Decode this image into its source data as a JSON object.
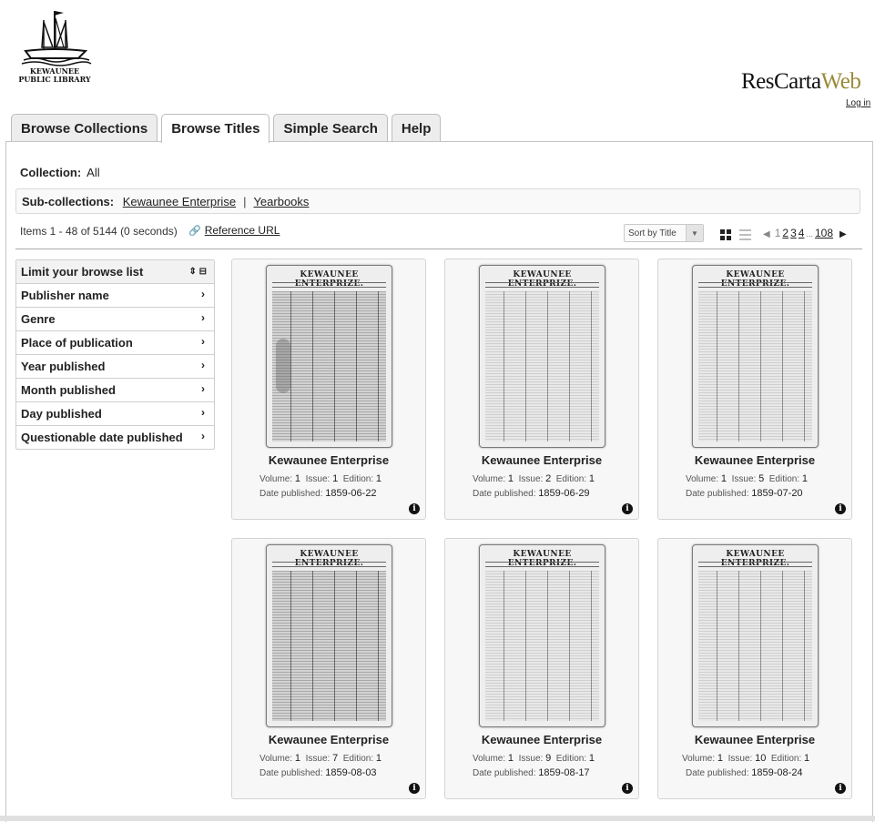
{
  "header": {
    "logo_line1": "KEWAUNEE",
    "logo_line2": "PUBLIC LIBRARY",
    "brand_main": "ResCarta",
    "brand_web": "Web",
    "login": "Log in"
  },
  "tabs": [
    {
      "label": "Browse Collections",
      "active": false
    },
    {
      "label": "Browse Titles",
      "active": true
    },
    {
      "label": "Simple Search",
      "active": false
    },
    {
      "label": "Help",
      "active": false
    }
  ],
  "collection": {
    "label": "Collection:",
    "value": "All"
  },
  "subcollections": {
    "label": "Sub-collections:",
    "items": [
      "Kewaunee Enterprise",
      "Yearbooks"
    ],
    "separator": "|"
  },
  "results": {
    "summary": "Items 1 - 48 of 5144 (0 seconds)",
    "reference_url": "Reference URL"
  },
  "sort": {
    "selected": "Sort by Title"
  },
  "pager": {
    "current": "1",
    "pages": [
      "2",
      "3",
      "4"
    ],
    "ellipsis": "...",
    "last": "108"
  },
  "facets": {
    "header": "Limit your browse list",
    "items": [
      "Publisher name",
      "Genre",
      "Place of publication",
      "Year published",
      "Month published",
      "Day published",
      "Questionable date published"
    ]
  },
  "card_labels": {
    "volume": "Volume:",
    "issue": "Issue:",
    "edition": "Edition:",
    "date": "Date published:"
  },
  "cards": [
    {
      "masthead": "KEWAUNEE ENTERPRIZE.",
      "title": "Kewaunee Enterprise",
      "volume": "1",
      "issue": "1",
      "edition": "1",
      "date": "1859-06-22"
    },
    {
      "masthead": "KEWAUNEE ENTERPRIZE.",
      "title": "Kewaunee Enterprise",
      "volume": "1",
      "issue": "2",
      "edition": "1",
      "date": "1859-06-29"
    },
    {
      "masthead": "KEWAUNEE ENTERPRIZE.",
      "title": "Kewaunee Enterprise",
      "volume": "1",
      "issue": "5",
      "edition": "1",
      "date": "1859-07-20"
    },
    {
      "masthead": "KEWAUNEE ENTERPRIZE.",
      "title": "Kewaunee Enterprise",
      "volume": "1",
      "issue": "7",
      "edition": "1",
      "date": "1859-08-03"
    },
    {
      "masthead": "KEWAUNEE ENTERPRIZE.",
      "title": "Kewaunee Enterprise",
      "volume": "1",
      "issue": "9",
      "edition": "1",
      "date": "1859-08-17"
    },
    {
      "masthead": "KEWAUNEE ENTERPRIZE.",
      "title": "Kewaunee Enterprise",
      "volume": "1",
      "issue": "10",
      "edition": "1",
      "date": "1859-08-24"
    }
  ],
  "colors": {
    "brand_web": "#9b8a3a",
    "tab_bg": "#ededed",
    "card_bg": "#f7f7f7"
  }
}
